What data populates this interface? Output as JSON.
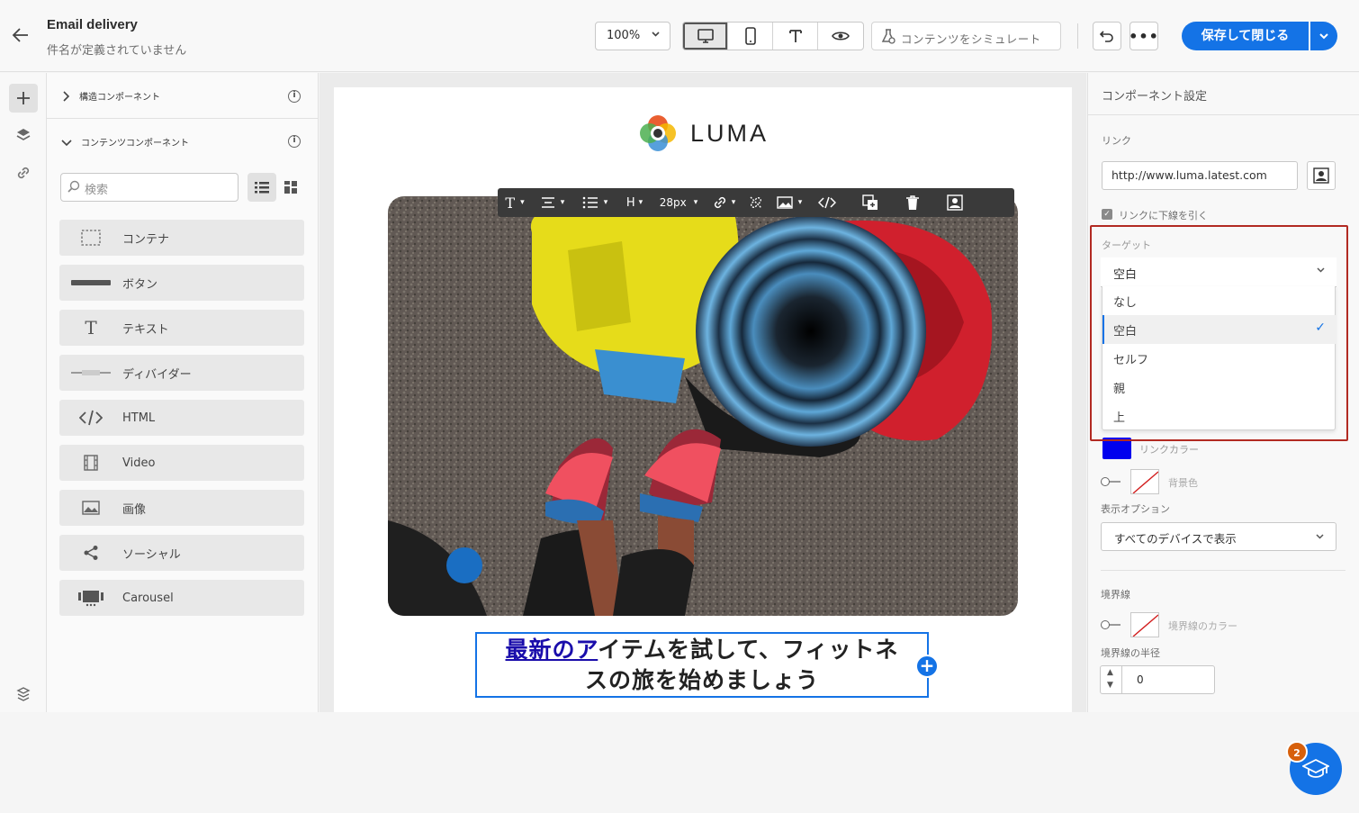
{
  "header": {
    "title": "Email delivery",
    "subtitle": "件名が定義されていません",
    "zoom": "100%",
    "simulate_label": "コンテンツをシミュレート",
    "save_label": "保存して閉じる"
  },
  "left_panel": {
    "structure_label": "構造コンポーネント",
    "content_label": "コンテンツコンポーネント",
    "search_placeholder": "検索",
    "components": [
      {
        "label": "コンテナ",
        "icon": "container-icon"
      },
      {
        "label": "ボタン",
        "icon": "button-icon"
      },
      {
        "label": "テキスト",
        "icon": "text-icon"
      },
      {
        "label": "ディバイダー",
        "icon": "divider-icon"
      },
      {
        "label": "HTML",
        "icon": "html-icon"
      },
      {
        "label": "Video",
        "icon": "video-icon"
      },
      {
        "label": "画像",
        "icon": "image-icon"
      },
      {
        "label": "ソーシャル",
        "icon": "share-icon"
      },
      {
        "label": "Carousel",
        "icon": "carousel-icon"
      }
    ]
  },
  "email": {
    "brand": "LUMA",
    "font_size": "28px",
    "heading_char": "H",
    "headline_link": "最新のア",
    "headline_line1_rest": "イテムを試して、フィットネ",
    "headline_line2": "スの旅を始めましょう"
  },
  "right_panel": {
    "title": "コンポーネント設定",
    "link_label": "リンク",
    "link_value": "http://www.luma.latest.com",
    "underline_label": "リンクに下線を引く",
    "target_label": "ターゲット",
    "target_selected": "空白",
    "target_options": [
      "なし",
      "空白",
      "セルフ",
      "親",
      "上"
    ],
    "link_color_label": "リンクカラー",
    "link_color": "#0000ee",
    "bg_color_label": "背景色",
    "display_options_label": "表示オプション",
    "display_value": "すべてのデバイスで表示",
    "border_label": "境界線",
    "border_color_label": "境界線のカラー",
    "border_radius_label": "境界線の半径",
    "border_radius_value": "0"
  },
  "help": {
    "badge_count": "2"
  },
  "colors": {
    "accent": "#1473e6",
    "highlight": "#b22a22"
  }
}
